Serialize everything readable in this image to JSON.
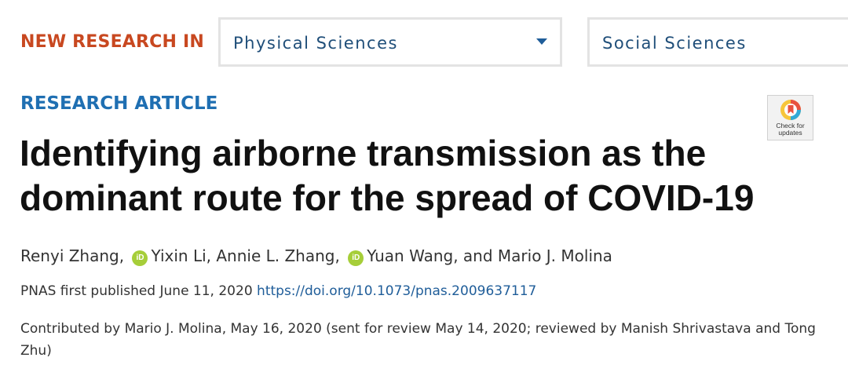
{
  "header": {
    "label": "NEW RESEARCH IN",
    "dropdown_physical": "Physical Sciences",
    "dropdown_social": "Social Sciences"
  },
  "article": {
    "type": "RESEARCH ARTICLE",
    "title": "Identifying airborne transmission as the dominant route for the spread of COVID-19",
    "authors": {
      "a1": "Renyi Zhang,",
      "a2": "Yixin Li, Annie L. Zhang,",
      "a3": "Yuan Wang, and Mario J. Molina",
      "orcid_label": "iD"
    },
    "published_prefix": "PNAS first published June 11, 2020",
    "doi": "https://doi.org/10.1073/pnas.2009637117",
    "contributed": "Contributed by Mario J. Molina, May 16, 2020 (sent for review May 14, 2020; reviewed by Manish Shrivastava and Tong Zhu)"
  },
  "check_updates": {
    "label_line1": "Check for",
    "label_line2": "updates"
  },
  "colors": {
    "header_label": "#c84820",
    "article_type": "#1f6fb2",
    "dropdown_text": "#1f4e79",
    "link": "#1f5d99",
    "orcid": "#a6ce39"
  },
  "icons": {
    "dropdown": "chevron-down-icon",
    "orcid": "orcid-icon",
    "check_updates": "check-for-updates-icon"
  }
}
